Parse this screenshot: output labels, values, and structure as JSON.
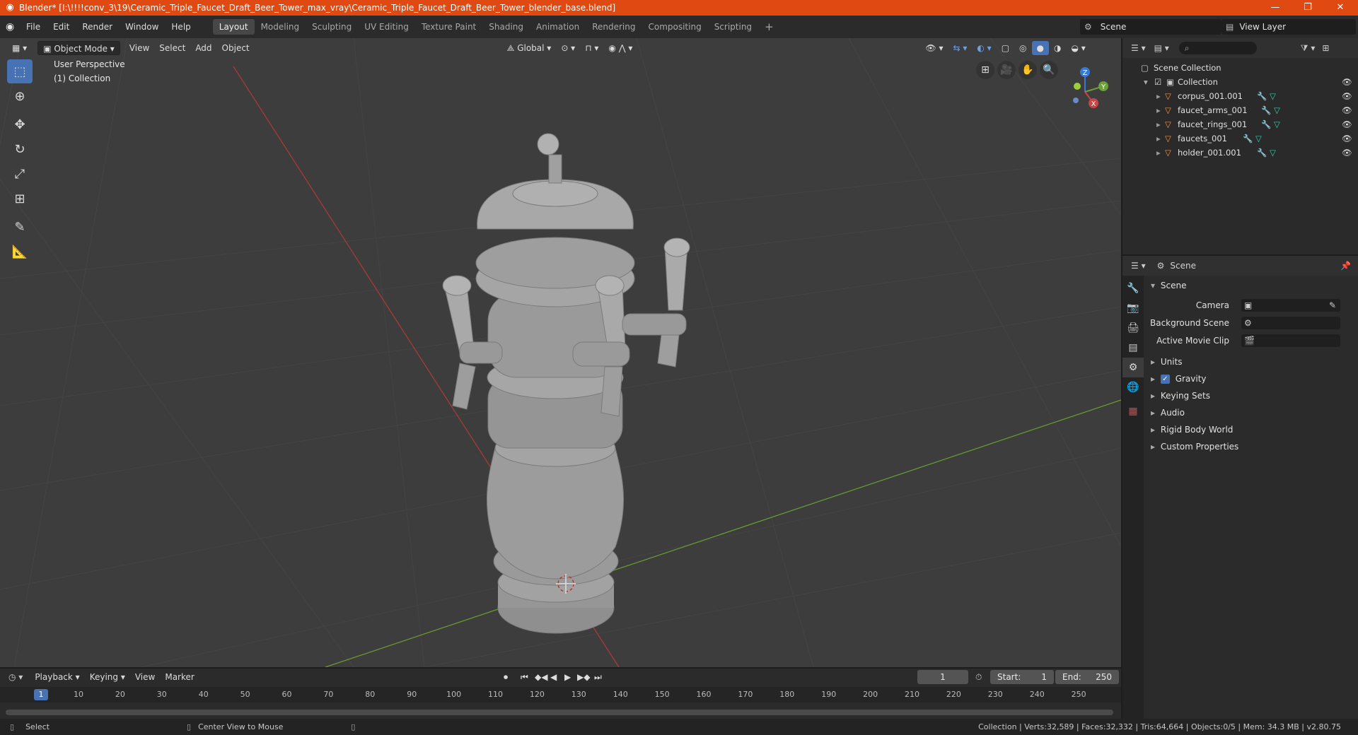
{
  "titlebar": {
    "title": "Blender* [I:\\!!!!conv_3\\19\\Ceramic_Triple_Faucet_Draft_Beer_Tower_max_vray\\Ceramic_Triple_Faucet_Draft_Beer_Tower_blender_base.blend]",
    "minimize": "—",
    "restore": "❐",
    "close": "✕"
  },
  "menubar": {
    "menus": [
      "File",
      "Edit",
      "Render",
      "Window",
      "Help"
    ],
    "workspaces": [
      "Layout",
      "Modeling",
      "Sculpting",
      "UV Editing",
      "Texture Paint",
      "Shading",
      "Animation",
      "Rendering",
      "Compositing",
      "Scripting"
    ],
    "active_workspace": "Layout",
    "add_tab": "+",
    "scene_label": "Scene",
    "view_layer_label": "View Layer"
  },
  "viewport": {
    "mode": "Object Mode",
    "menus": [
      "View",
      "Select",
      "Add",
      "Object"
    ],
    "orientation": "Global",
    "perspective_label": "User Perspective",
    "collection_label": "(1) Collection",
    "gizmo": {
      "x": "X",
      "y": "Y",
      "z": "Z"
    }
  },
  "outliner": {
    "root": "Scene Collection",
    "collection": "Collection",
    "objects": [
      "corpus_001.001",
      "faucet_arms_001",
      "faucet_rings_001",
      "faucets_001",
      "holder_001.001"
    ]
  },
  "properties": {
    "header_title": "Scene",
    "section": "Scene",
    "camera_label": "Camera",
    "background_scene_label": "Background Scene",
    "active_movie_clip_label": "Active Movie Clip",
    "panels": [
      "Units",
      "Gravity",
      "Keying Sets",
      "Audio",
      "Rigid Body World",
      "Custom Properties"
    ],
    "gravity_checked": true
  },
  "timeline": {
    "menus": [
      "Playback",
      "Keying",
      "View",
      "Marker"
    ],
    "current_frame": "1",
    "start_label": "Start:",
    "start_value": "1",
    "end_label": "End:",
    "end_value": "250",
    "ruler": [
      "1",
      "10",
      "20",
      "30",
      "40",
      "50",
      "60",
      "70",
      "80",
      "90",
      "100",
      "110",
      "120",
      "130",
      "140",
      "150",
      "160",
      "170",
      "180",
      "190",
      "200",
      "210",
      "220",
      "230",
      "240",
      "250"
    ]
  },
  "statusbar": {
    "select": "Select",
    "center_view": "Center View to Mouse",
    "stats": "Collection | Verts:32,589 | Faces:32,332 | Tris:64,664 | Objects:0/5 | Mem: 34.3 MB | v2.80.75"
  },
  "colors": {
    "titlebar": "#e04a12",
    "accent": "#4772b3",
    "object_icon": "#e8964a",
    "mesh_icon": "#3fc7a6",
    "viewport_bg": "#3d3d3d"
  }
}
